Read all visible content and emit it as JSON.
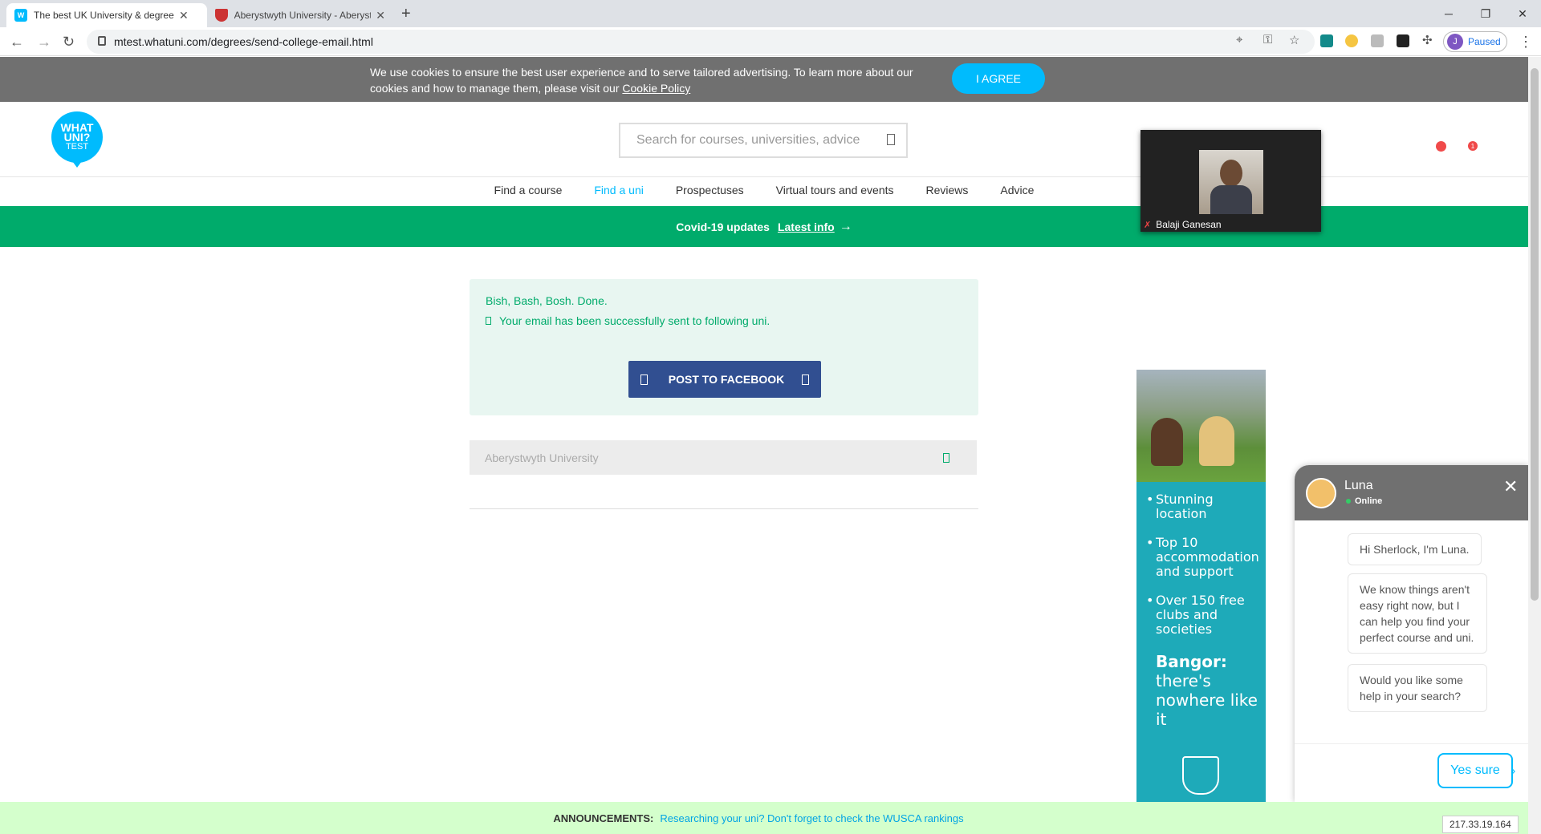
{
  "browser": {
    "tabs": [
      {
        "title": "The best UK University & degree",
        "favicon": "W",
        "active": true
      },
      {
        "title": "Aberystwyth University - Aberyst",
        "favicon": "crest",
        "active": false
      }
    ],
    "url": "mtest.whatuni.com/degrees/send-college-email.html",
    "profile_initial": "J",
    "profile_status": "Paused"
  },
  "cookie_banner": {
    "text": "We use cookies to ensure the best user experience and to serve tailored advertising. To learn more about our cookies and how to manage them, please visit our",
    "link": "Cookie Policy",
    "agree_label": "I AGREE"
  },
  "header": {
    "logo_line1": "WHAT",
    "logo_line2": "UNI?",
    "logo_line3": "TEST",
    "search_placeholder": "Search for courses, universities, advice",
    "notification_count": "1"
  },
  "nav": {
    "items": [
      "Find a course",
      "Find a uni",
      "Prospectuses",
      "Virtual tours and events",
      "Reviews",
      "Advice"
    ],
    "active": "Find a uni"
  },
  "covid": {
    "label": "Covid-19 updates",
    "link": "Latest info",
    "arrow": "→"
  },
  "video_call": {
    "participant": "Balaji Ganesan"
  },
  "success": {
    "heading": "Bish, Bash, Bosh. Done.",
    "message": "Your email has been successfully sent to following uni.",
    "facebook_label": "POST TO FACEBOOK"
  },
  "uni_row": {
    "name": "Aberystwyth University"
  },
  "ad": {
    "bullets": [
      "Stunning location",
      "Top 10 accommodation and support",
      "Over 150 free clubs and societies"
    ],
    "tagline_bold": "Bangor:",
    "tagline": "there's nowhere like it"
  },
  "chat": {
    "agent_name": "Luna",
    "status": "Online",
    "messages": [
      "Hi Sherlock, I'm Luna.",
      "We know things aren't easy right now, but I can help you find your perfect course and uni.",
      "Would you like some help in your search?"
    ],
    "reply_label": "Yes sure"
  },
  "announcement": {
    "label": "ANNOUNCEMENTS:",
    "text": "Researching your uni? Don't forget to check the WUSCA rankings"
  },
  "ip_badge": "217.33.19.164",
  "colors": {
    "brand": "#00bbfd",
    "covid_green": "#00ab6b",
    "facebook": "#314f91",
    "ad_teal": "#1eaab9"
  }
}
